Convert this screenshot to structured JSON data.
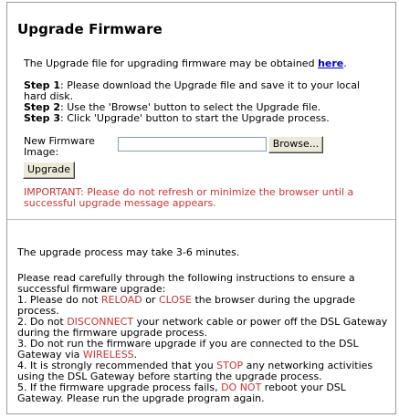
{
  "title": "Upgrade Firmware",
  "intro": {
    "text": "The Upgrade file for upgrading firmware may be obtained",
    "link": "here",
    "end": "."
  },
  "steps": [
    {
      "label": "Step 1",
      "text": ": Please download the Upgrade file and save it to your local hard disk."
    },
    {
      "label": "Step 2",
      "text": ": Use the 'Browse' button to select the Upgrade file."
    },
    {
      "label": "Step 3",
      "text": ": Click 'Upgrade' button to start the Upgrade process."
    }
  ],
  "form": {
    "field_label": "New Firmware Image:",
    "file_value": "",
    "browse_label": "Browse...",
    "upgrade_label": "Upgrade"
  },
  "important": "IMPORTANT: Please do not refresh or minimize the browser until a successful upgrade message appears.",
  "duration": "The upgrade process may take 3-6 minutes.",
  "instructions": {
    "intro": "Please read carefully through the following instructions to ensure a successful firmware upgrade:",
    "i1": {
      "a": "1. Please do not ",
      "k1": "RELOAD",
      "b": " or ",
      "k2": "CLOSE",
      "c": " the browser during the upgrade process."
    },
    "i2": {
      "a": "2. Do not ",
      "k1": "DISCONNECT",
      "b": " your network cable or power off the DSL Gateway during the firmware upgrade process."
    },
    "i3": {
      "a": "3. Do not run the firmware upgrade if you are connected to the DSL Gateway via ",
      "k1": "WIRELESS",
      "b": "."
    },
    "i4": {
      "a": "4. It is strongly recommended that you ",
      "k1": "STOP",
      "b": " any networking activities using the DSL Gateway before starting the upgrade process."
    },
    "i5": {
      "a": "5. If the firmware upgrade process fails, ",
      "k1": "DO NOT",
      "b": " reboot your DSL Gateway. Please run the upgrade program again."
    }
  },
  "colors": {
    "warning": "#cc3333",
    "link": "#0000cc",
    "border": "#9c9c9c"
  }
}
